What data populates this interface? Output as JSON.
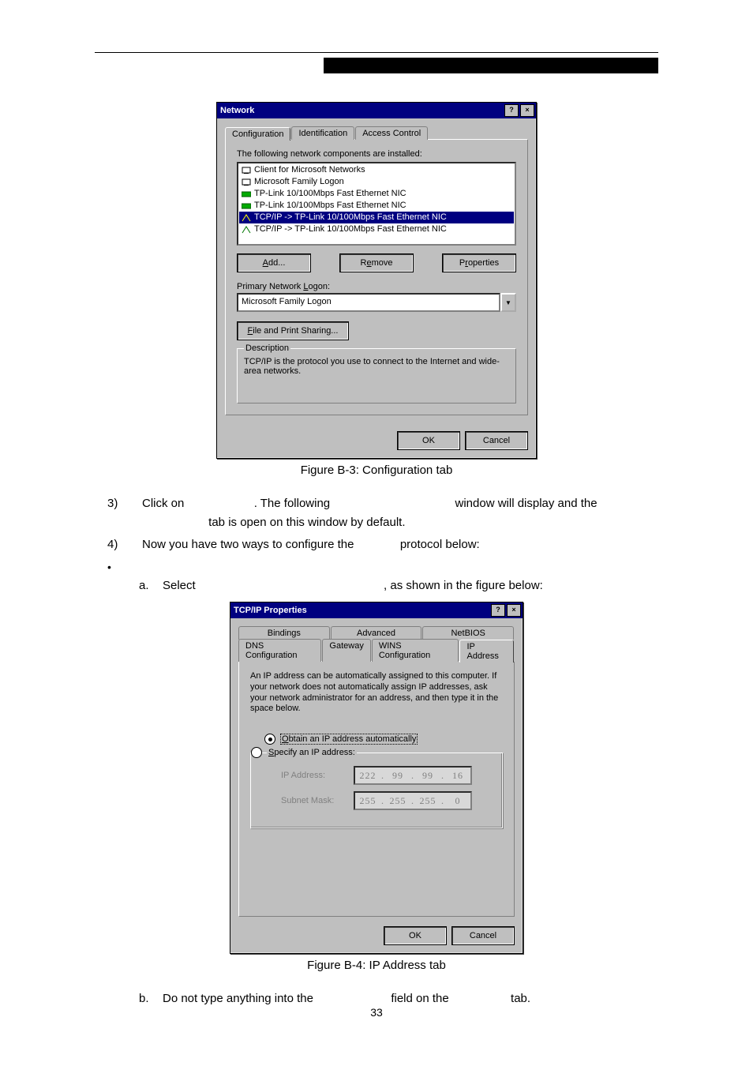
{
  "header": {
    "black_bar": ""
  },
  "dialog1": {
    "title": "Network",
    "help_glyph": "?",
    "close_glyph": "×",
    "tabs": {
      "config": "Configuration",
      "ident": "Identification",
      "access": "Access Control"
    },
    "intro": "The following network components are installed:",
    "items": [
      "Client for Microsoft Networks",
      "Microsoft Family Logon",
      "TP-Link 10/100Mbps Fast Ethernet NIC",
      "TP-Link 10/100Mbps Fast Ethernet NIC",
      "TCP/IP -> TP-Link 10/100Mbps Fast Ethernet NIC",
      "TCP/IP -> TP-Link 10/100Mbps Fast Ethernet NIC"
    ],
    "btns": {
      "add": "Add...",
      "remove": "Remove",
      "properties": "Properties"
    },
    "primary_label": "Primary Network Logon:",
    "primary_value": "Microsoft Family Logon",
    "fps": "File and Print Sharing...",
    "desc_legend": "Description",
    "desc_text": "TCP/IP is the protocol you use to connect to the Internet and wide-area networks.",
    "ok": "OK",
    "cancel": "Cancel"
  },
  "captions": {
    "fig1": "Figure B-3: Configuration tab",
    "fig2": "Figure B-4: IP Address tab"
  },
  "steps": {
    "s3_num": "3)",
    "s3_a": "Click on ",
    "s3_b": ". The following ",
    "s3_c": " window will display and the ",
    "s3_d": " tab is open on this window by default.",
    "s4_num": "4)",
    "s4_a": "Now you have two ways to configure the ",
    "s4_b": " protocol below:",
    "sub_a_num": "a.",
    "sub_a_a": "Select ",
    "sub_a_b": ", as shown in the figure below:",
    "sub_b_num": "b.",
    "sub_b_a": "Do not type anything into the ",
    "sub_b_b": " field on the ",
    "sub_b_c": " tab."
  },
  "dialog2": {
    "title": "TCP/IP Properties",
    "help_glyph": "?",
    "close_glyph": "×",
    "tabs_row1": {
      "bindings": "Bindings",
      "advanced": "Advanced",
      "netbios": "NetBIOS"
    },
    "tabs_row2": {
      "dns": "DNS Configuration",
      "gateway": "Gateway",
      "wins": "WINS Configuration",
      "ip": "IP Address"
    },
    "blurb": "An IP address can be automatically assigned to this computer. If your network does not automatically assign IP addresses, ask your network administrator for an address, and then type it in the space below.",
    "radio1": "Obtain an IP address automatically",
    "radio2": "Specify an IP address:",
    "ip_label": "IP Address:",
    "mask_label": "Subnet Mask:",
    "ip_value": [
      "222",
      "99",
      "99",
      "16"
    ],
    "mask_value": [
      "255",
      "255",
      "255",
      "0"
    ],
    "ok": "OK",
    "cancel": "Cancel"
  },
  "page_number": "33"
}
